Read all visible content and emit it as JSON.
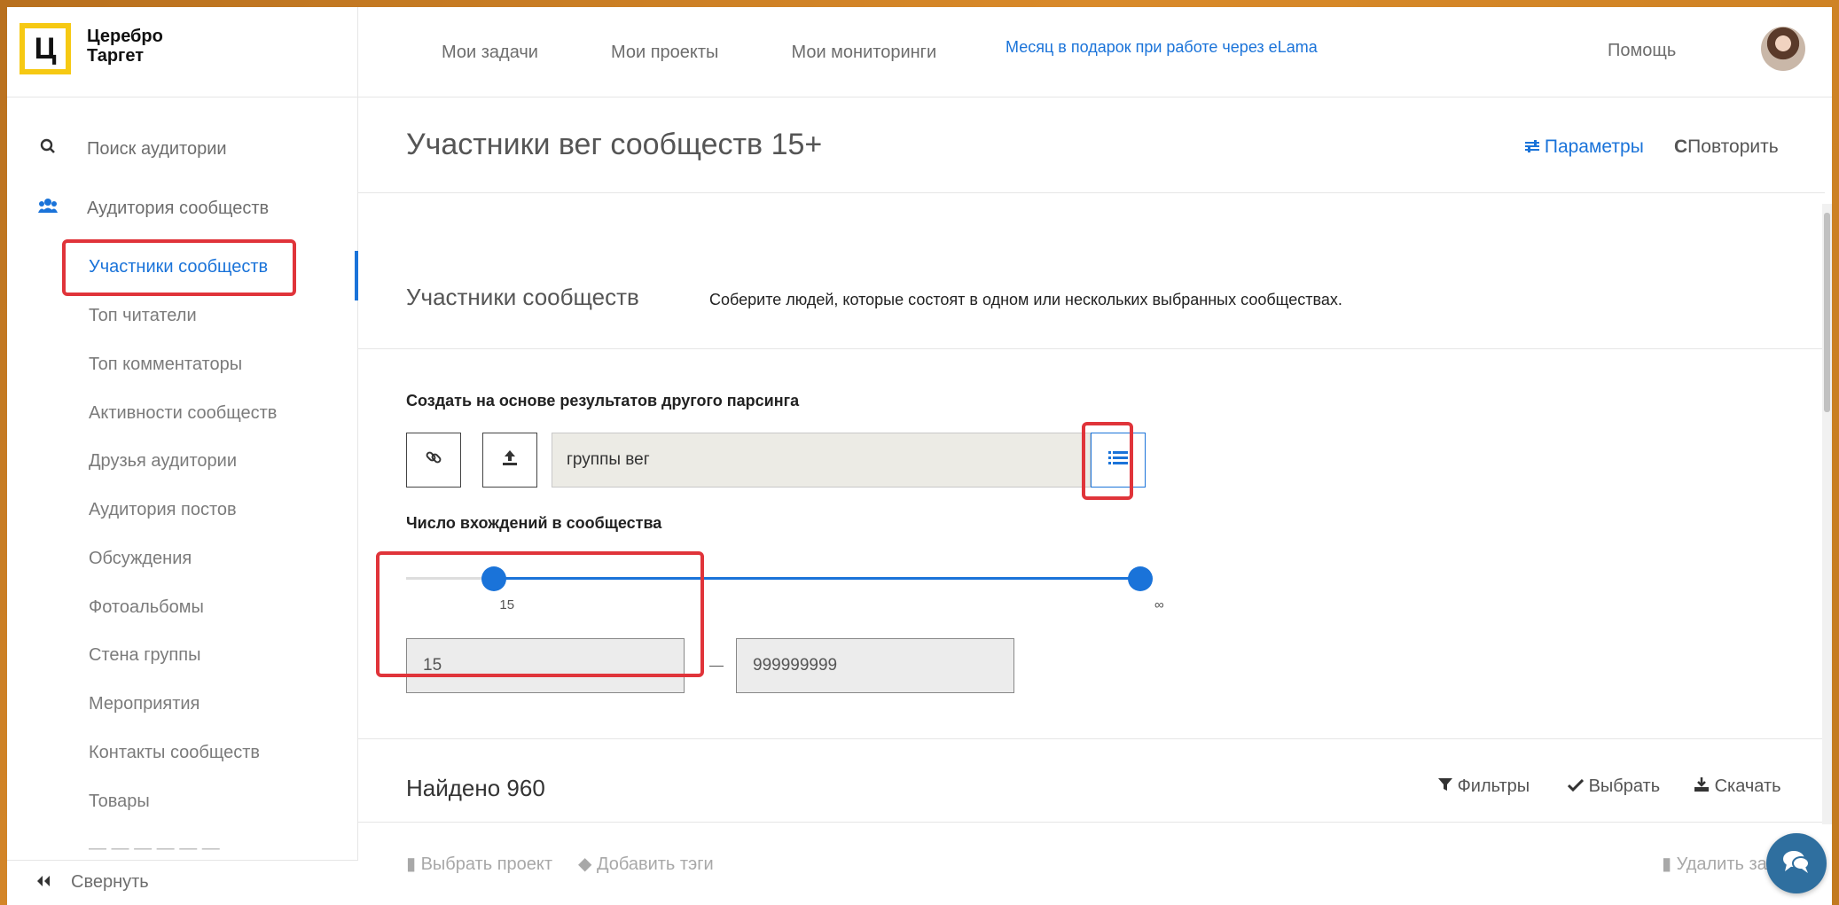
{
  "brand": {
    "logo_letter": "Ц",
    "name_line1": "Церебро",
    "name_line2": "Таргет",
    "accent": "#f6c913"
  },
  "nav": {
    "items": [
      "Мои задачи",
      "Мои проекты",
      "Мои мониторинги"
    ],
    "promo": "Месяц в подарок при работе через eLama",
    "help": "Помощь"
  },
  "sidebar": {
    "main": [
      {
        "label": "Поиск аудитории",
        "icon": "search-icon"
      },
      {
        "label": "Аудитория сообществ",
        "icon": "users-icon"
      }
    ],
    "sub": [
      "Участники сообществ",
      "Топ читатели",
      "Топ комментаторы",
      "Активности сообществ",
      "Друзья аудитории",
      "Аудитория постов",
      "Обсуждения",
      "Фотоальбомы",
      "Стена группы",
      "Мероприятия",
      "Контакты сообществ",
      "Товары"
    ],
    "active_index": 0,
    "collapse": "Свернуть"
  },
  "main": {
    "title": "Участники вег сообществ 15+",
    "params": "Параметры",
    "repeat": "Повторить",
    "section_title": "Участники сообществ",
    "section_desc": "Соберите людей, которые состоят в одном или нескольких выбранных сообществах.",
    "form": {
      "based_on_label": "Создать на основе результатов другого парсинга",
      "source_value": "группы вег",
      "occurrences_label": "Число вхождений в сообщества",
      "slider_min_label": "15",
      "slider_max_label": "∞",
      "min_value": "15",
      "max_value": "999999999",
      "slider_min_fraction": 0.12
    },
    "found": {
      "title": "Найдено 960",
      "filters": "Фильтры",
      "select": "Выбрать",
      "download": "Скачать"
    },
    "bottom": {
      "choose_project": "Выбрать проект",
      "add_tags": "Добавить тэги",
      "delete": "Удалить за"
    }
  },
  "colors": {
    "link": "#1a73d9",
    "highlight": "#e0343a"
  }
}
